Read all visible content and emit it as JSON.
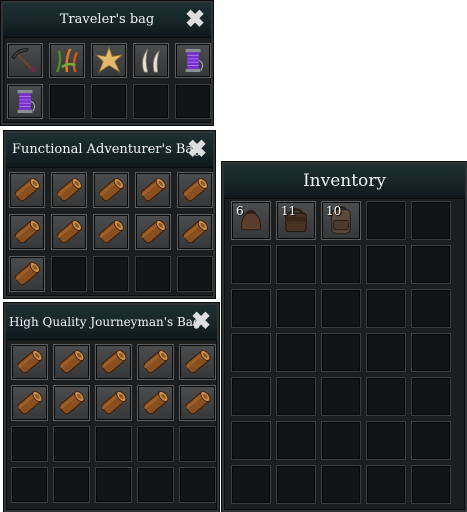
{
  "bags": [
    {
      "title": "Traveler's bag",
      "close_icon": "close-x-icon",
      "slots": [
        {
          "icon": "pickaxe-icon"
        },
        {
          "icon": "herb-bundle-icon"
        },
        {
          "icon": "starfish-hide-icon"
        },
        {
          "icon": "claws-icon"
        },
        {
          "icon": "thread-spool-icon"
        },
        {
          "icon": "thread-spool-icon"
        },
        {
          "icon": ""
        },
        {
          "icon": ""
        },
        {
          "icon": ""
        },
        {
          "icon": ""
        }
      ]
    },
    {
      "title": "Functional Adventurer's Bag",
      "close_icon": "close-x-icon",
      "slots": [
        {
          "icon": "log-icon"
        },
        {
          "icon": "log-icon"
        },
        {
          "icon": "log-icon"
        },
        {
          "icon": "log-icon"
        },
        {
          "icon": "log-icon"
        },
        {
          "icon": "log-icon"
        },
        {
          "icon": "log-icon"
        },
        {
          "icon": "log-icon"
        },
        {
          "icon": "log-icon"
        },
        {
          "icon": "log-icon"
        },
        {
          "icon": "log-icon"
        },
        {
          "icon": ""
        },
        {
          "icon": ""
        },
        {
          "icon": ""
        },
        {
          "icon": ""
        }
      ]
    },
    {
      "title": "Inventory",
      "slots": [
        {
          "icon": "leather-pouch-icon",
          "count": "6"
        },
        {
          "icon": "leather-bag-icon",
          "count": "11"
        },
        {
          "icon": "leather-backpack-icon",
          "count": "10"
        },
        {
          "icon": ""
        },
        {
          "icon": ""
        },
        {
          "icon": ""
        },
        {
          "icon": ""
        },
        {
          "icon": ""
        },
        {
          "icon": ""
        },
        {
          "icon": ""
        },
        {
          "icon": ""
        },
        {
          "icon": ""
        },
        {
          "icon": ""
        },
        {
          "icon": ""
        },
        {
          "icon": ""
        },
        {
          "icon": ""
        },
        {
          "icon": ""
        },
        {
          "icon": ""
        },
        {
          "icon": ""
        },
        {
          "icon": ""
        },
        {
          "icon": ""
        },
        {
          "icon": ""
        },
        {
          "icon": ""
        },
        {
          "icon": ""
        },
        {
          "icon": ""
        },
        {
          "icon": ""
        },
        {
          "icon": ""
        },
        {
          "icon": ""
        },
        {
          "icon": ""
        },
        {
          "icon": ""
        },
        {
          "icon": ""
        },
        {
          "icon": ""
        },
        {
          "icon": ""
        },
        {
          "icon": ""
        },
        {
          "icon": ""
        }
      ]
    },
    {
      "title": "High Quality Journeyman's Bag",
      "close_icon": "close-x-icon",
      "slots": [
        {
          "icon": "log-icon"
        },
        {
          "icon": "log-icon"
        },
        {
          "icon": "log-icon"
        },
        {
          "icon": "log-icon"
        },
        {
          "icon": "log-icon"
        },
        {
          "icon": "log-icon"
        },
        {
          "icon": "log-icon"
        },
        {
          "icon": "log-icon"
        },
        {
          "icon": "log-icon"
        },
        {
          "icon": "log-icon"
        },
        {
          "icon": ""
        },
        {
          "icon": ""
        },
        {
          "icon": ""
        },
        {
          "icon": ""
        },
        {
          "icon": ""
        },
        {
          "icon": ""
        },
        {
          "icon": ""
        },
        {
          "icon": ""
        },
        {
          "icon": ""
        },
        {
          "icon": ""
        }
      ]
    }
  ],
  "colors": {
    "panel_bg": "#1b1d1e",
    "header_teal": "#1c2f31",
    "slot_empty": "#111314",
    "slot_filled": "#4a4c4d"
  }
}
